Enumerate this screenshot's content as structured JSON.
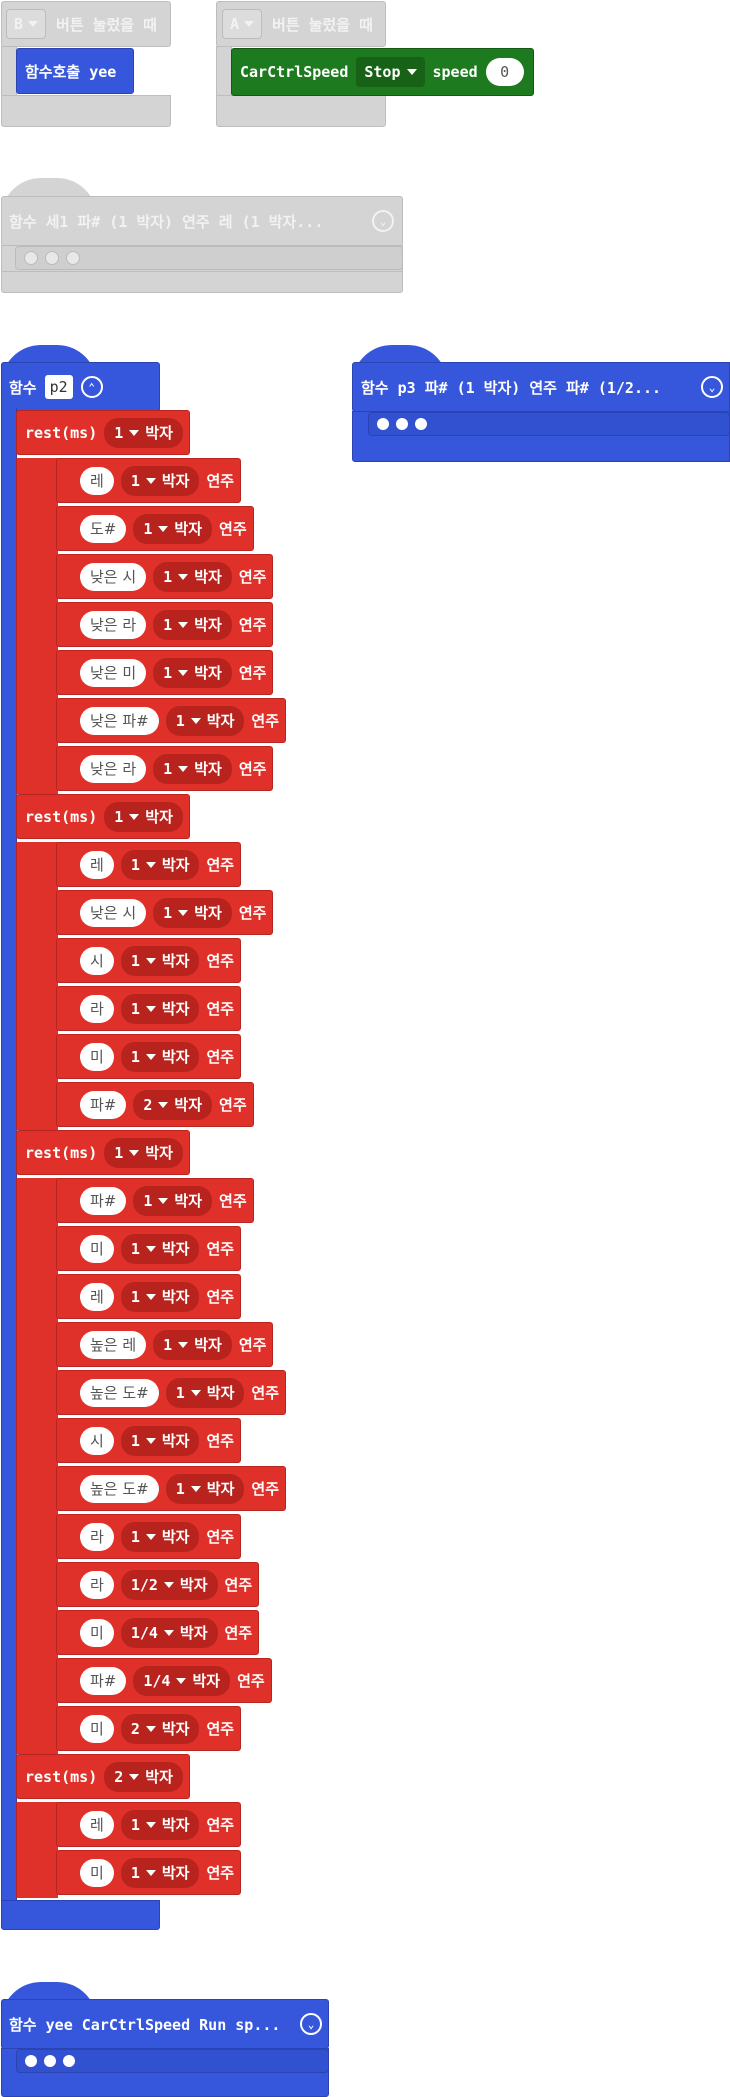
{
  "btn_b_event": {
    "button": "B",
    "label": "버튼 눌렀을 때",
    "call": "함수호출 yee"
  },
  "btn_a_event": {
    "button": "A",
    "label": "버튼 눌렀을 때",
    "cmd": "CarCtrlSpeed",
    "mode": "Stop",
    "speed_label": "speed",
    "speed_value": "0"
  },
  "func_collapsed": {
    "label": "함수 세1  파# (1 박자) 연주 레 (1 박자..."
  },
  "func_p2": {
    "keyword": "함수",
    "name": "p2"
  },
  "func_p3": {
    "label": "함수 p3  파# (1 박자) 연주 파# (1/2..."
  },
  "func_yee": {
    "label": "함수 yee  CarCtrlSpeed Run sp..."
  },
  "labels": {
    "rest": "rest(ms)",
    "beat": "박자",
    "play": "연주"
  },
  "notes": [
    {
      "type": "rest",
      "beat": "1"
    },
    {
      "type": "note",
      "note": "레",
      "beat": "1"
    },
    {
      "type": "note",
      "note": "도#",
      "beat": "1"
    },
    {
      "type": "note",
      "note": "낮은 시",
      "beat": "1"
    },
    {
      "type": "note",
      "note": "낮은 라",
      "beat": "1"
    },
    {
      "type": "note",
      "note": "낮은 미",
      "beat": "1"
    },
    {
      "type": "note",
      "note": "낮은 파#",
      "beat": "1"
    },
    {
      "type": "note",
      "note": "낮은 라",
      "beat": "1"
    },
    {
      "type": "rest",
      "beat": "1"
    },
    {
      "type": "note",
      "note": "레",
      "beat": "1"
    },
    {
      "type": "note",
      "note": "낮은 시",
      "beat": "1"
    },
    {
      "type": "note",
      "note": "시",
      "beat": "1"
    },
    {
      "type": "note",
      "note": "라",
      "beat": "1"
    },
    {
      "type": "note",
      "note": "미",
      "beat": "1"
    },
    {
      "type": "note",
      "note": "파#",
      "beat": "2"
    },
    {
      "type": "rest",
      "beat": "1"
    },
    {
      "type": "note",
      "note": "파#",
      "beat": "1"
    },
    {
      "type": "note",
      "note": "미",
      "beat": "1"
    },
    {
      "type": "note",
      "note": "레",
      "beat": "1"
    },
    {
      "type": "note",
      "note": "높은 레",
      "beat": "1"
    },
    {
      "type": "note",
      "note": "높은 도#",
      "beat": "1"
    },
    {
      "type": "note",
      "note": "시",
      "beat": "1"
    },
    {
      "type": "note",
      "note": "높은 도#",
      "beat": "1"
    },
    {
      "type": "note",
      "note": "라",
      "beat": "1"
    },
    {
      "type": "note",
      "note": "라",
      "beat": "1/2"
    },
    {
      "type": "note",
      "note": "미",
      "beat": "1/4"
    },
    {
      "type": "note",
      "note": "파#",
      "beat": "1/4"
    },
    {
      "type": "note",
      "note": "미",
      "beat": "2"
    },
    {
      "type": "rest",
      "beat": "2"
    },
    {
      "type": "note",
      "note": "레",
      "beat": "1"
    },
    {
      "type": "note",
      "note": "미",
      "beat": "1"
    }
  ],
  "colors": {
    "function": "#3657dc",
    "music": "#e0302a",
    "car": "#1e7a1e",
    "disabled": "#d4d4d4"
  }
}
